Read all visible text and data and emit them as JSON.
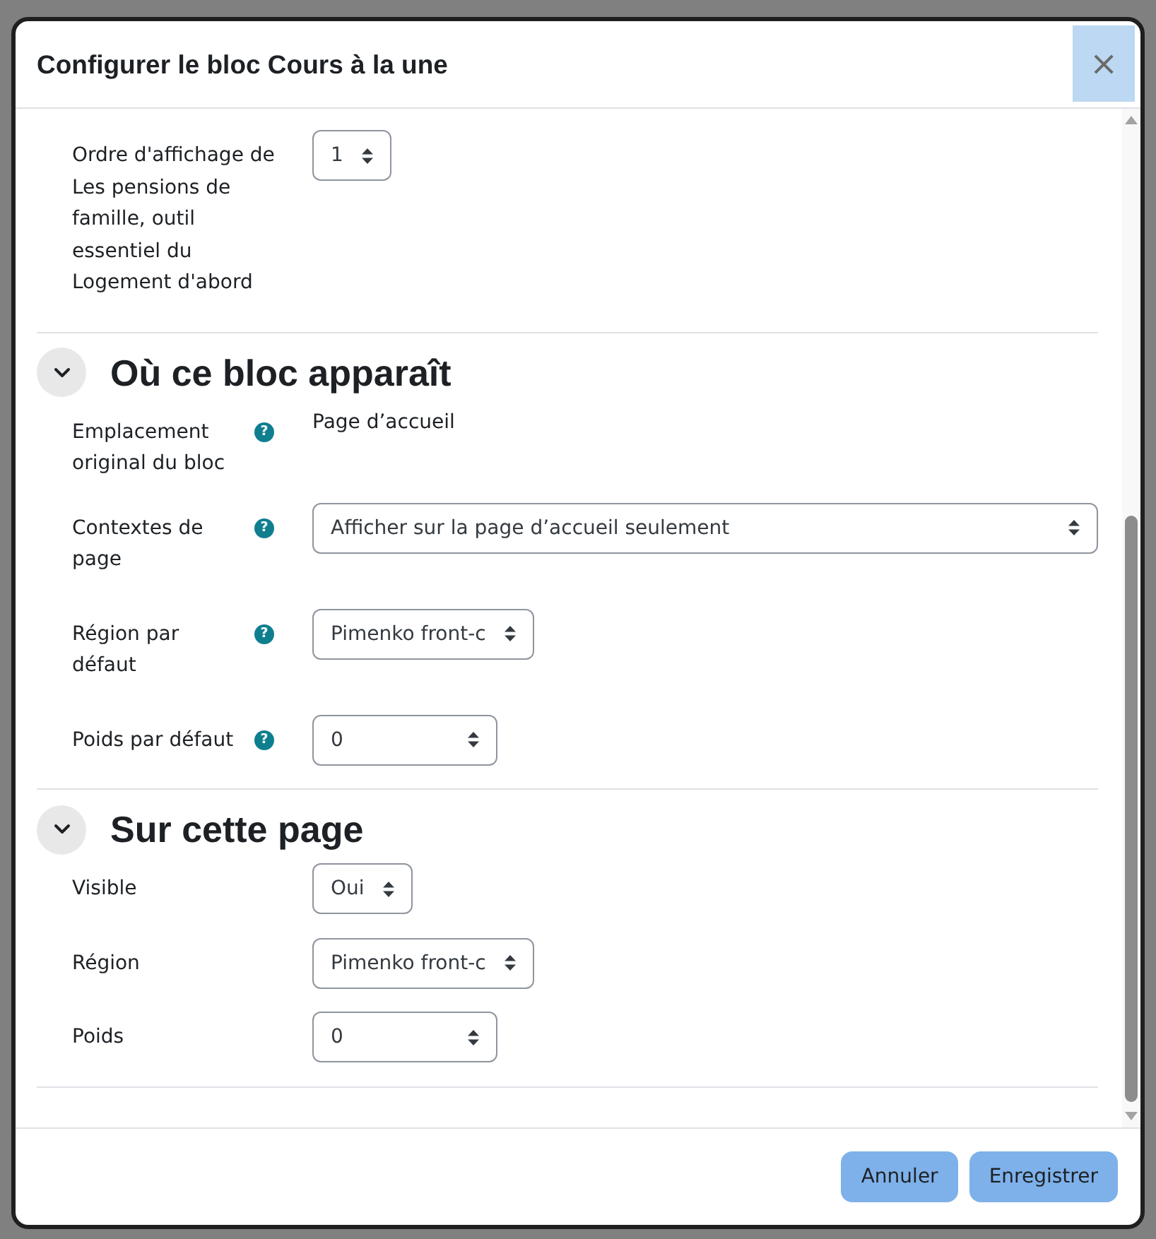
{
  "dialog": {
    "title": "Configurer le bloc Cours à la une",
    "close": "×"
  },
  "fields": [
    {
      "label": "Ordre d'affichage de Les pensions de famille, outil essentiel du Logement d'abord",
      "kind": "select",
      "value": "1"
    }
  ],
  "sections": [
    {
      "title": "Où ce bloc apparaît",
      "expanded": true,
      "fields": [
        {
          "label": "Emplacement original du bloc",
          "help": "?",
          "kind": "static",
          "value": "Page d’accueil"
        },
        {
          "label": "Contextes de page",
          "help": "?",
          "kind": "wide-select",
          "value": "Afficher sur la page d’accueil seulement"
        },
        {
          "label": "Région par défaut",
          "help": "?",
          "kind": "select",
          "value": "Pimenko front-c"
        },
        {
          "label": "Poids par défaut",
          "help": "?",
          "kind": "select",
          "value": "0"
        }
      ]
    },
    {
      "title": "Sur cette page",
      "expanded": true,
      "fields": [
        {
          "label": "Visible",
          "kind": "select",
          "value": "Oui"
        },
        {
          "label": "Région",
          "kind": "select",
          "value": "Pimenko front-c"
        },
        {
          "label": "Poids",
          "kind": "select",
          "value": "0"
        }
      ]
    }
  ],
  "buttons": [
    {
      "label": "Annuler"
    },
    {
      "label": "Enregistrer"
    }
  ]
}
